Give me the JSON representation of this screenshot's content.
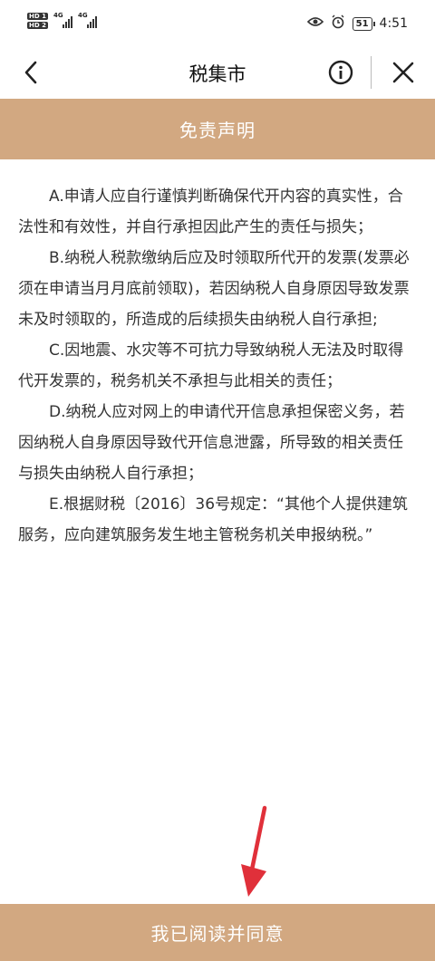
{
  "status_bar": {
    "hd1": "HD 1",
    "hd2": "HD 2",
    "net1": "4G",
    "net2": "4G",
    "battery": "51",
    "time": "4:51"
  },
  "title_bar": {
    "title": "税集市"
  },
  "header": {
    "title": "免责声明"
  },
  "disclaimer": {
    "items": [
      "A.申请人应自行谨慎判断确保代开内容的真实性，合法性和有效性，并自行承担因此产生的责任与损失；",
      "B.纳税人税款缴纳后应及时领取所代开的发票(发票必须在申请当月月底前领取)，若因纳税人自身原因导致发票未及时领取的，所造成的后续损失由纳税人自行承担;",
      "C.因地震、水灾等不可抗力导致纳税人无法及时取得代开发票的，税务机关不承担与此相关的责任；",
      "D.纳税人应对网上的申请代开信息承担保密义务，若因纳税人自身原因导致代开信息泄露，所导致的相关责任与损失由纳税人自行承担；",
      "E.根据财税〔2016〕36号规定：“其他个人提供建筑服务，应向建筑服务发生地主管税务机关申报纳税。”"
    ]
  },
  "footer": {
    "agree_label": "我已阅读并同意"
  },
  "colors": {
    "accent": "#d2a881",
    "annotation_arrow": "#e0303a"
  }
}
